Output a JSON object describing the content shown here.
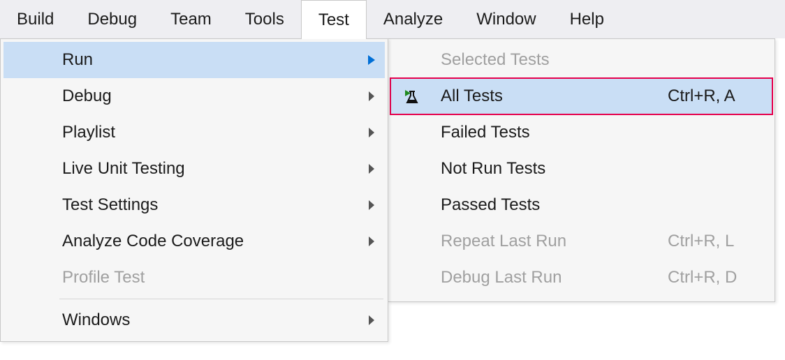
{
  "menuBar": {
    "items": [
      {
        "label": "Build",
        "name": "menu-build"
      },
      {
        "label": "Debug",
        "name": "menu-debug"
      },
      {
        "label": "Team",
        "name": "menu-team"
      },
      {
        "label": "Tools",
        "name": "menu-tools"
      },
      {
        "label": "Test",
        "name": "menu-test",
        "active": true
      },
      {
        "label": "Analyze",
        "name": "menu-analyze"
      },
      {
        "label": "Window",
        "name": "menu-window"
      },
      {
        "label": "Help",
        "name": "menu-help"
      }
    ]
  },
  "testMenu": {
    "items": [
      {
        "label": "Run",
        "name": "test-run",
        "submenu": true,
        "highlighted": true
      },
      {
        "label": "Debug",
        "name": "test-debug",
        "submenu": true
      },
      {
        "label": "Playlist",
        "name": "test-playlist",
        "submenu": true
      },
      {
        "label": "Live Unit Testing",
        "name": "test-live-unit-testing",
        "submenu": true
      },
      {
        "label": "Test Settings",
        "name": "test-test-settings",
        "submenu": true
      },
      {
        "label": "Analyze Code Coverage",
        "name": "test-analyze-code-coverage",
        "submenu": true
      },
      {
        "label": "Profile Test",
        "name": "test-profile-test",
        "disabled": true
      },
      {
        "separator": true
      },
      {
        "label": "Windows",
        "name": "test-windows",
        "submenu": true
      }
    ]
  },
  "runMenu": {
    "items": [
      {
        "label": "Selected Tests",
        "name": "run-selected-tests",
        "disabled": true
      },
      {
        "label": "All Tests",
        "name": "run-all-tests",
        "shortcut": "Ctrl+R, A",
        "icon": "flask",
        "highlightedRed": true
      },
      {
        "label": "Failed Tests",
        "name": "run-failed-tests"
      },
      {
        "label": "Not Run Tests",
        "name": "run-not-run-tests"
      },
      {
        "label": "Passed Tests",
        "name": "run-passed-tests"
      },
      {
        "label": "Repeat Last Run",
        "name": "run-repeat-last-run",
        "shortcut": "Ctrl+R, L",
        "disabled": true
      },
      {
        "label": "Debug Last Run",
        "name": "run-debug-last-run",
        "shortcut": "Ctrl+R, D",
        "disabled": true
      }
    ]
  }
}
